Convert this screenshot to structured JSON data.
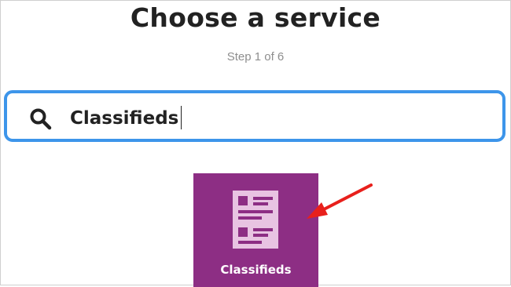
{
  "page": {
    "title": "Choose a service",
    "step": "Step 1 of 6"
  },
  "search": {
    "value": "Classifieds",
    "icon": "search-icon"
  },
  "results": [
    {
      "label": "Classifieds",
      "icon": "classifieds-icon",
      "color": "#8d2e84"
    }
  ],
  "annotation": {
    "icon": "arrow-icon",
    "color": "#e8201c"
  }
}
